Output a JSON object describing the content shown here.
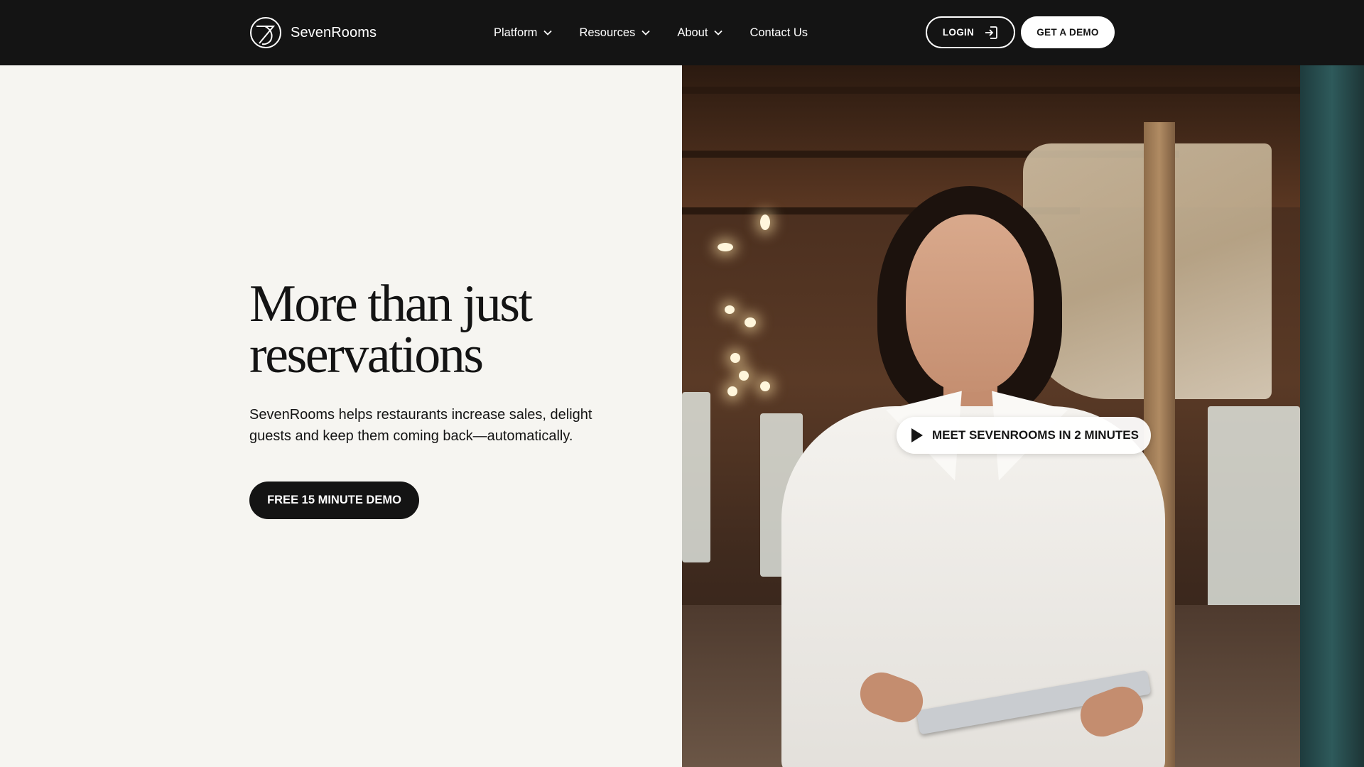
{
  "header": {
    "logo_text": "SevenRooms",
    "logo_icon": "sevenrooms-logo-icon",
    "nav": [
      {
        "label": "Platform",
        "has_dropdown": true
      },
      {
        "label": "Resources",
        "has_dropdown": true
      },
      {
        "label": "About",
        "has_dropdown": true
      },
      {
        "label": "Contact Us",
        "has_dropdown": false
      }
    ],
    "login_label": "LOGIN",
    "demo_label": "GET A DEMO"
  },
  "hero": {
    "headline_line1": "More than just",
    "headline_line2": "reservations",
    "subtext_line1": "SevenRooms helps restaurants increase sales, delight",
    "subtext_line2": "guests and keep them coming back—automatically.",
    "cta_label": "FREE 15 MINUTE DEMO",
    "video_label": "MEET SEVENROOMS IN 2 MINUTES"
  },
  "colors": {
    "nav_bg": "#141414",
    "page_bg": "#f6f5f1",
    "text": "#141414",
    "button_dark": "#141414",
    "button_light": "#ffffff"
  }
}
